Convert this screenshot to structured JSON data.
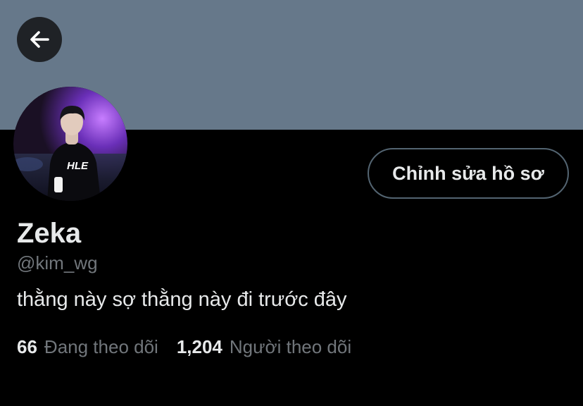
{
  "header": {
    "back_icon": "arrow-left-icon",
    "banner_color": "#66788a"
  },
  "profile": {
    "display_name": "Zeka",
    "username": "@kim_wg",
    "bio": "thằng này sợ thằng này đi trước đây",
    "edit_button_label": "Chỉnh sửa hồ sơ",
    "avatar_shirt_text": "HLE"
  },
  "stats": {
    "following": {
      "count": "66",
      "label": "Đang theo dõi"
    },
    "followers": {
      "count": "1,204",
      "label": "Người theo dõi"
    }
  },
  "colors": {
    "background": "#000000",
    "primary_text": "#e7e9ea",
    "secondary_text": "#71767b",
    "button_border": "#536471"
  }
}
